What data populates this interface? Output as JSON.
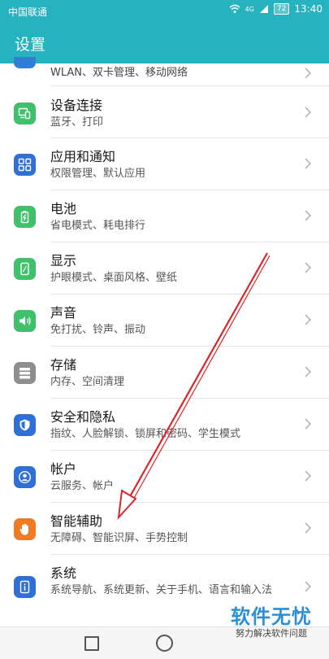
{
  "status_bar": {
    "carrier": "中国联通",
    "network": "4G",
    "battery": "72",
    "time": "13:40"
  },
  "header": {
    "title": "设置"
  },
  "settings": {
    "items": [
      {
        "title": "",
        "subtitle": "WLAN、双卡管理、移动网络",
        "icon": "network-icon",
        "color": "#2f7fd4"
      },
      {
        "title": "设备连接",
        "subtitle": "蓝牙、打印",
        "icon": "device-connection-icon",
        "color": "#3fc06b"
      },
      {
        "title": "应用和通知",
        "subtitle": "权限管理、默认应用",
        "icon": "apps-grid-icon",
        "color": "#2f6fd6"
      },
      {
        "title": "电池",
        "subtitle": "省电模式、耗电排行",
        "icon": "battery-icon",
        "color": "#3fc06b"
      },
      {
        "title": "显示",
        "subtitle": "护眼模式、桌面风格、壁纸",
        "icon": "display-icon",
        "color": "#3fc06b"
      },
      {
        "title": "声音",
        "subtitle": "免打扰、铃声、振动",
        "icon": "sound-icon",
        "color": "#3fc06b"
      },
      {
        "title": "存储",
        "subtitle": "内存、空间清理",
        "icon": "storage-icon",
        "color": "#8e8e8e"
      },
      {
        "title": "安全和隐私",
        "subtitle": "指纹、人脸解锁、锁屏和密码、学生模式",
        "icon": "shield-icon",
        "color": "#2f6fd6"
      },
      {
        "title": "帐户",
        "subtitle": "云服务、帐户",
        "icon": "account-icon",
        "color": "#2f6fd6"
      },
      {
        "title": "智能辅助",
        "subtitle": "无障碍、智能识屏、手势控制",
        "icon": "hand-icon",
        "color": "#f07b24"
      },
      {
        "title": "系统",
        "subtitle": "系统导航、系统更新、关于手机、语言和输入法",
        "icon": "system-info-icon",
        "color": "#2f6fd6"
      }
    ]
  },
  "watermark": {
    "title": "软件无忧",
    "subtitle": "努力解决软件问题"
  }
}
